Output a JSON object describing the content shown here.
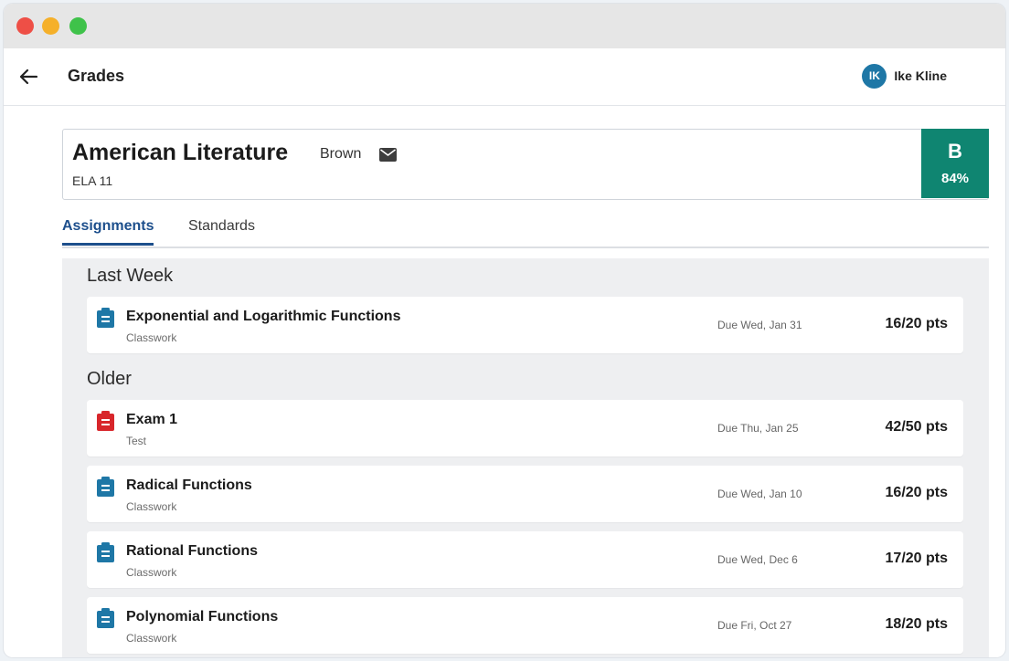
{
  "colors": {
    "grade_green": "#0f8571",
    "tab_active": "#1d4f8c",
    "avatar_blue": "#1e77a6",
    "classwork_icon": "#1e77a6",
    "test_icon": "#d8262b"
  },
  "header": {
    "title": "Grades",
    "back_icon": "arrow-left-icon",
    "user": {
      "initials": "IK",
      "name": "Ike Kline"
    }
  },
  "course": {
    "name": "American Literature",
    "teacher": "Brown",
    "code": "ELA 11",
    "grade_letter": "B",
    "grade_percent": "84%"
  },
  "tabs": [
    {
      "label": "Assignments",
      "active": true
    },
    {
      "label": "Standards",
      "active": false
    }
  ],
  "sections": [
    {
      "heading": "Last Week",
      "items": [
        {
          "title": "Exponential and Logarithmic Functions",
          "type": "Classwork",
          "due": "Due Wed, Jan 31",
          "points": "16/20 pts",
          "icon": "clipboard-icon"
        }
      ]
    },
    {
      "heading": "Older",
      "items": [
        {
          "title": "Exam 1",
          "type": "Test",
          "due": "Due Thu, Jan 25",
          "points": "42/50 pts",
          "icon": "clipboard-icon"
        },
        {
          "title": "Radical Functions",
          "type": "Classwork",
          "due": "Due Wed, Jan 10",
          "points": "16/20 pts",
          "icon": "clipboard-icon"
        },
        {
          "title": "Rational Functions",
          "type": "Classwork",
          "due": "Due Wed, Dec 6",
          "points": "17/20 pts",
          "icon": "clipboard-icon"
        },
        {
          "title": "Polynomial Functions",
          "type": "Classwork",
          "due": "Due Fri, Oct 27",
          "points": "18/20 pts",
          "icon": "clipboard-icon"
        }
      ]
    }
  ]
}
